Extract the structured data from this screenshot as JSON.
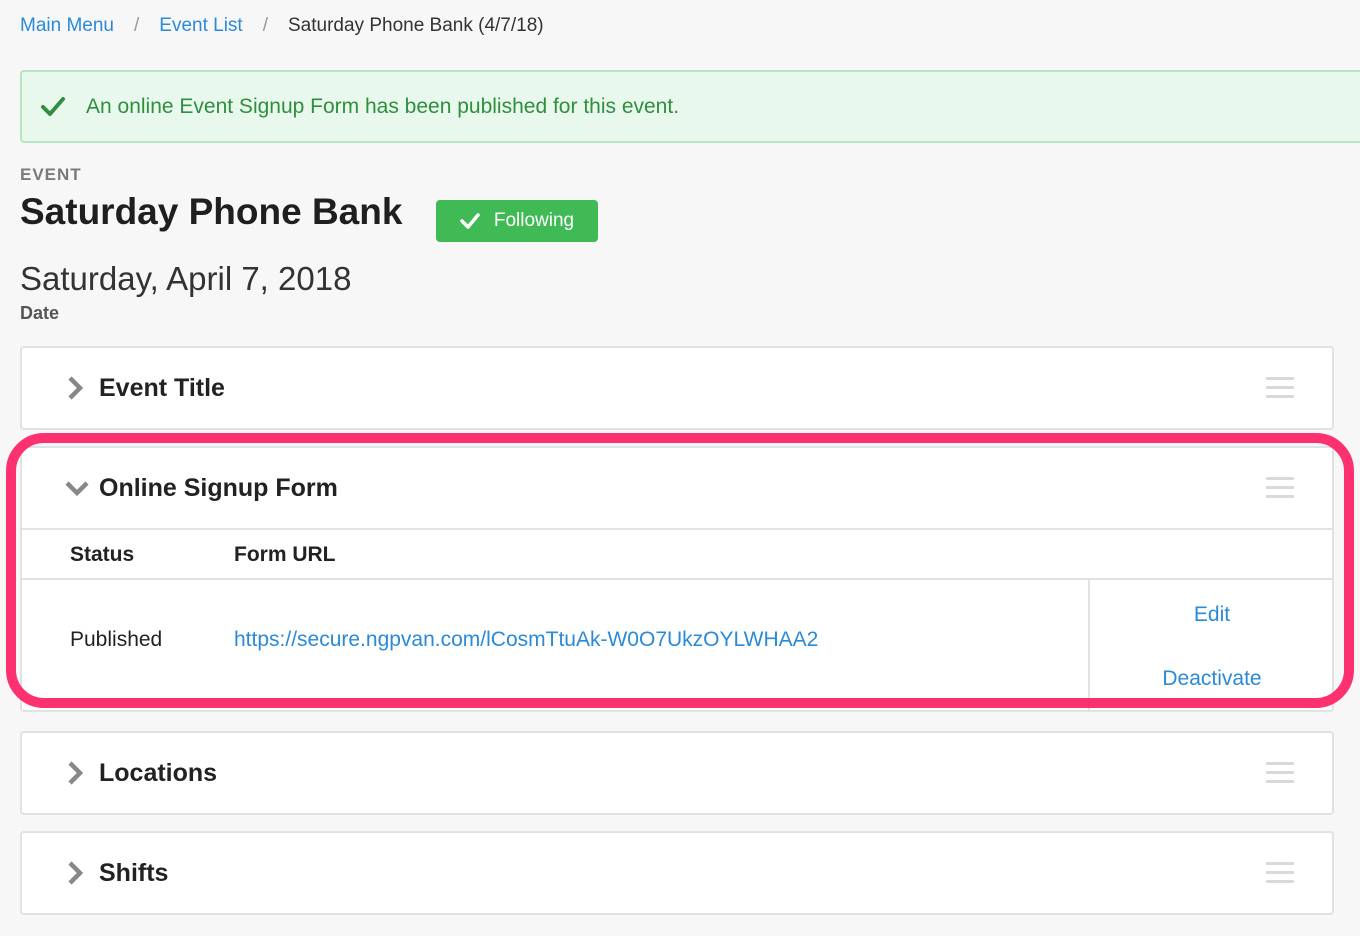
{
  "breadcrumb": {
    "main_menu": "Main Menu",
    "separator": "/",
    "event_list": "Event List",
    "current": "Saturday Phone Bank (4/7/18)"
  },
  "alert": {
    "icon": "check-icon",
    "text": "An online Event Signup Form has been published for this event.",
    "color": "#2f8f3e"
  },
  "event": {
    "eyebrow": "EVENT",
    "title": "Saturday Phone Bank",
    "follow_label": "Following",
    "date": "Saturday, April 7, 2018",
    "date_label": "Date"
  },
  "panels": {
    "event_title": {
      "title": "Event Title",
      "expanded": false
    },
    "signup_form": {
      "title": "Online Signup Form",
      "expanded": true,
      "columns": [
        "Status",
        "Form URL"
      ],
      "row": {
        "status": "Published",
        "url": "https://secure.ngpvan.com/lCosmTtuAk-W0O7UkzOYLWHAA2",
        "edit_label": "Edit",
        "deactivate_label": "Deactivate"
      }
    },
    "locations": {
      "title": "Locations",
      "expanded": false
    },
    "shifts": {
      "title": "Shifts",
      "expanded": false
    }
  },
  "colors": {
    "link": "#2b8ad8",
    "success": "#3fba54",
    "highlight": "#fd3070"
  }
}
